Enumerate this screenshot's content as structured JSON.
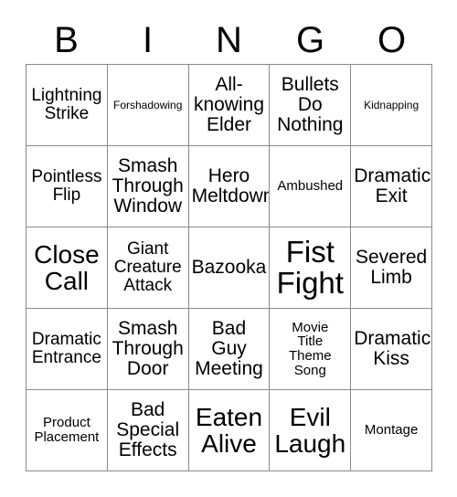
{
  "card": {
    "header_letters": [
      "B",
      "I",
      "N",
      "G",
      "O"
    ],
    "rows": [
      [
        {
          "text": "Lightning\nStrike",
          "size": "sm"
        },
        {
          "text": "Forshadowing",
          "size": "xxs"
        },
        {
          "text": "All-\nknowing\nElder",
          "size": "md"
        },
        {
          "text": "Bullets\nDo\nNothing",
          "size": "md"
        },
        {
          "text": "Kidnapping",
          "size": "xxs"
        }
      ],
      [
        {
          "text": "Pointless\nFlip",
          "size": "sm"
        },
        {
          "text": "Smash\nThrough\nWindow",
          "size": "md"
        },
        {
          "text": "Hero\nMeltdown",
          "size": "md"
        },
        {
          "text": "Ambushed",
          "size": "xs"
        },
        {
          "text": "Dramatic\nExit",
          "size": "md"
        }
      ],
      [
        {
          "text": "Close\nCall",
          "size": "lg"
        },
        {
          "text": "Giant\nCreature\nAttack",
          "size": "sm"
        },
        {
          "text": "Bazooka",
          "size": "md"
        },
        {
          "text": "Fist\nFight",
          "size": "xl"
        },
        {
          "text": "Severed\nLimb",
          "size": "md"
        }
      ],
      [
        {
          "text": "Dramatic\nEntrance",
          "size": "sm"
        },
        {
          "text": "Smash\nThrough\nDoor",
          "size": "md"
        },
        {
          "text": "Bad\nGuy\nMeeting",
          "size": "md"
        },
        {
          "text": "Movie\nTitle\nTheme\nSong",
          "size": "xs"
        },
        {
          "text": "Dramatic\nKiss",
          "size": "md"
        }
      ],
      [
        {
          "text": "Product\nPlacement",
          "size": "xs"
        },
        {
          "text": "Bad\nSpecial\nEffects",
          "size": "md"
        },
        {
          "text": "Eaten\nAlive",
          "size": "lg"
        },
        {
          "text": "Evil\nLaugh",
          "size": "lg"
        },
        {
          "text": "Montage",
          "size": "xs"
        }
      ]
    ]
  },
  "colors": {
    "background": "#ffffff",
    "text": "#000000",
    "grid_line": "#8a8a8a"
  }
}
